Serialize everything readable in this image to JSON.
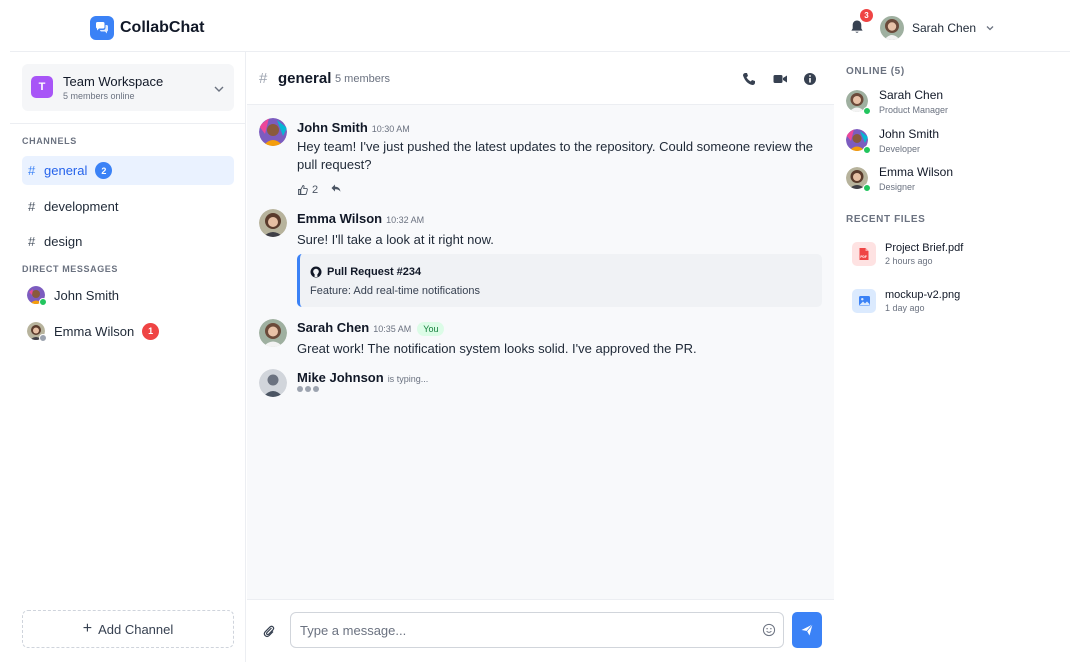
{
  "app": {
    "name": "CollabChat"
  },
  "header": {
    "notification_count": "3",
    "user_name": "Sarah Chen"
  },
  "workspace": {
    "icon_letter": "T",
    "name": "Team Workspace",
    "status": "5 members online"
  },
  "sidebar": {
    "channels_label": "CHANNELS",
    "channels": [
      {
        "name": "general",
        "unread": "2",
        "active": true
      },
      {
        "name": "development",
        "unread": ""
      },
      {
        "name": "design",
        "unread": ""
      }
    ],
    "dm_label": "DIRECT MESSAGES",
    "direct_messages": [
      {
        "name": "John Smith",
        "status": "online",
        "unread": ""
      },
      {
        "name": "Emma Wilson",
        "status": "away",
        "unread": "1"
      }
    ],
    "add_channel_label": "Add Channel"
  },
  "channel": {
    "hash": "#",
    "name": "general",
    "members": "5 members"
  },
  "messages": [
    {
      "author": "John Smith",
      "time": "10:30 AM",
      "text": "Hey team! I've just pushed the latest updates to the repository. Could someone review the pull request?",
      "reaction_count": "2"
    },
    {
      "author": "Emma Wilson",
      "time": "10:32 AM",
      "text": "Sure! I'll take a look at it right now.",
      "card": {
        "title": "Pull Request #234",
        "description": "Feature: Add real-time notifications"
      }
    },
    {
      "author": "Sarah Chen",
      "time": "10:35 AM",
      "badge": "You",
      "text": "Great work! The notification system looks solid. I've approved the PR."
    }
  ],
  "typing": {
    "author": "Mike Johnson",
    "label": "is typing..."
  },
  "composer": {
    "placeholder": "Type a message..."
  },
  "right_sidebar": {
    "online_label": "ONLINE (5)",
    "members": [
      {
        "name": "Sarah Chen",
        "role": "Product Manager",
        "status": "online"
      },
      {
        "name": "John Smith",
        "role": "Developer",
        "status": "online"
      },
      {
        "name": "Emma Wilson",
        "role": "Designer",
        "status": "online"
      }
    ],
    "files_label": "RECENT FILES",
    "files": [
      {
        "name": "Project Brief.pdf",
        "time": "2 hours ago",
        "icon": "pdf-file-icon"
      },
      {
        "name": "mockup-v2.png",
        "time": "1 day ago",
        "icon": "image-file-icon"
      }
    ]
  },
  "colors": {
    "accent": "#3b82f6",
    "workspace_icon": "#a855f7",
    "badge_red": "#ef4444",
    "online": "#22c55e",
    "away": "#9ca3af"
  }
}
